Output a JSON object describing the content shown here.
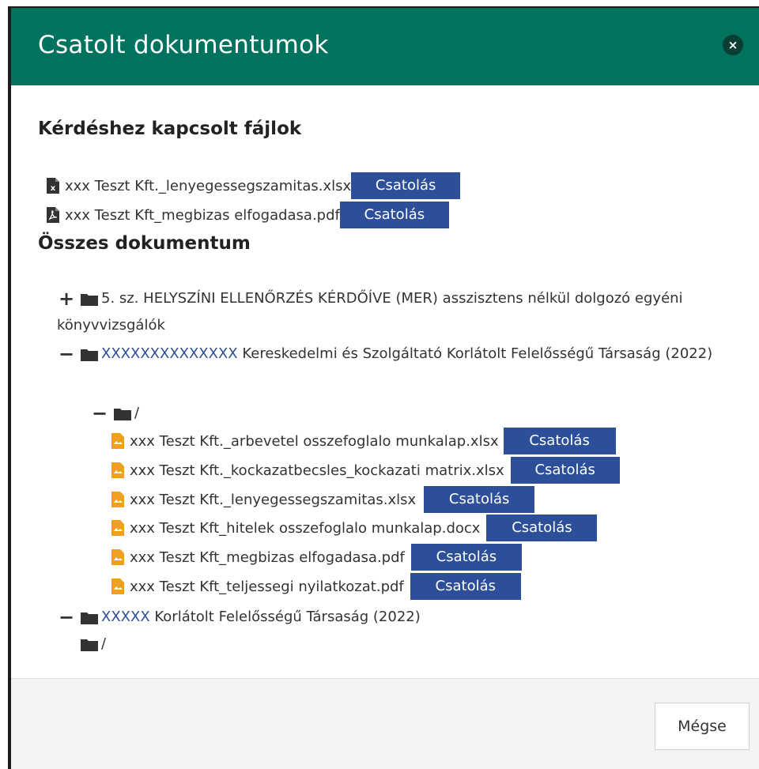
{
  "modal": {
    "title": "Csatolt dokumentumok",
    "close_label": "×"
  },
  "linked_files": {
    "title": "Kérdéshez kapcsolt fájlok",
    "items": [
      {
        "name": "xxx Teszt Kft._lenyegessegszamitas.xlsx",
        "icon": "excel-file-icon",
        "action": "Csatolás"
      },
      {
        "name": "xxx Teszt Kft_megbizas elfogadasa.pdf",
        "icon": "pdf-file-icon",
        "action": "Csatolás"
      }
    ]
  },
  "all_documents": {
    "title": "Összes dokumentum",
    "tree": [
      {
        "toggle": "+",
        "text": "5. sz. HELYSZÍNI ELLENŐRZÉS KÉRDŐÍVE (MER) asszisztens nélkül dolgozó egyéni könyvvizsgálók"
      },
      {
        "toggle": "−",
        "code": "XXXXXXXXXXXXXX",
        "text": " Kereskedelmi és Szolgáltató Korlátolt Felelősségű Társaság (2022)"
      },
      {
        "toggle": "−",
        "text": "/"
      },
      {
        "toggle": "−",
        "code": "XXXXX",
        "text": " Korlátolt Felelősségű Társaság (2022)"
      },
      {
        "text": "/"
      }
    ],
    "files": [
      {
        "name": "xxx Teszt Kft._arbevetel osszefoglalo munkalap.xlsx",
        "action": "Csatolás"
      },
      {
        "name": "xxx Teszt Kft._kockazatbecsles_kockazati matrix.xlsx",
        "action": "Csatolás"
      },
      {
        "name": "xxx Teszt Kft._lenyegessegszamitas.xlsx",
        "action": "Csatolás"
      },
      {
        "name": "xxx Teszt Kft_hitelek osszefoglalo munkalap.docx",
        "action": "Csatolás"
      },
      {
        "name": "xxx Teszt Kft_megbizas elfogadasa.pdf",
        "action": "Csatolás"
      },
      {
        "name": "xxx Teszt Kft_teljessegi nyilatkozat.pdf",
        "action": "Csatolás"
      }
    ]
  },
  "footer": {
    "cancel_label": "Mégse"
  },
  "colors": {
    "header": "#00735f",
    "button": "#2d4f9a",
    "file_icon": "#f0a020"
  }
}
